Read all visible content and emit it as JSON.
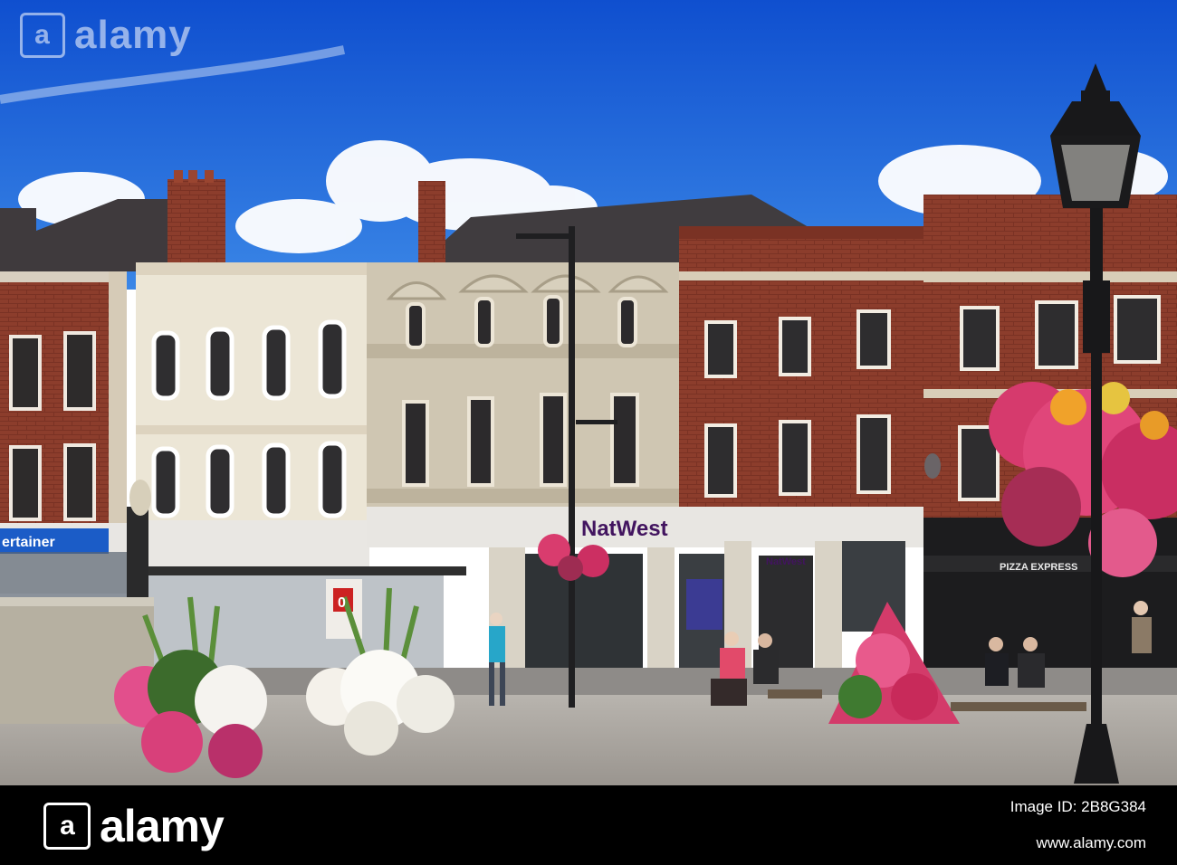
{
  "signs": {
    "bank_main": "NatWest",
    "bank_small": "NatWest",
    "left_shop": "ertainer",
    "restaurant": "PIZZA EXPRESS",
    "bus_stop": "0"
  },
  "watermark": {
    "brand": "alamy",
    "mark": "a"
  },
  "footer": {
    "brand": "alamy",
    "mark": "a",
    "image_id_label": "Image ID: 2B8G384",
    "url": "www.alamy.com"
  },
  "colors": {
    "sky": "#1a5fd8",
    "brick": "#8a3a2a",
    "natwest_purple": "#42145f",
    "flowers_pink": "#e0367a"
  }
}
